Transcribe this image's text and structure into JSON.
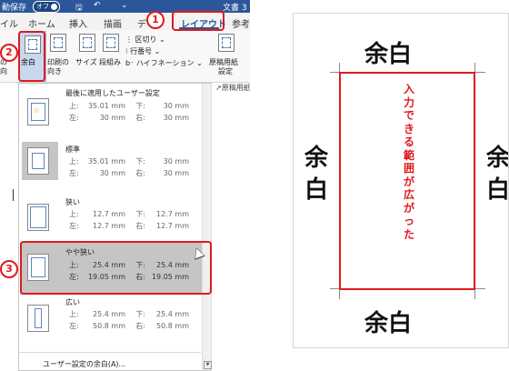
{
  "titlebar": {
    "autosave_left": "動保存",
    "autosave_state": "オフ",
    "doc_name": "文書 3 -"
  },
  "tabs": [
    "イル",
    "ホーム",
    "挿入",
    "描画",
    "デ",
    "レイアウト",
    "参考"
  ],
  "ribbon": {
    "margins_label": "余白",
    "orientation_label_1": "印刷の",
    "orientation_label_2": "向き",
    "size_label": "サイズ",
    "columns_label": "段組み",
    "breaks_label": "区切り",
    "line_numbers_label": "行番号",
    "hyphenation_label": "ハイフネーション",
    "manuscript_label_1": "原稿用紙",
    "manuscript_label_2": "設定",
    "left_cut_1": "の",
    "left_cut_2": "向",
    "side_group": "原稿用紙"
  },
  "margins_menu": {
    "options": [
      {
        "name": "最後に適用したユーザー設定",
        "top_label": "上:",
        "top": "35.01 mm",
        "bottom_label": "下:",
        "bottom": "30 mm",
        "left_label": "左:",
        "left": "30 mm",
        "right_label": "右:",
        "right": "30 mm"
      },
      {
        "name": "標準",
        "top_label": "上:",
        "top": "35.01 mm",
        "bottom_label": "下:",
        "bottom": "30 mm",
        "left_label": "左:",
        "left": "30 mm",
        "right_label": "右:",
        "right": "30 mm"
      },
      {
        "name": "狭い",
        "top_label": "上:",
        "top": "12.7 mm",
        "bottom_label": "下:",
        "bottom": "12.7 mm",
        "left_label": "左:",
        "left": "12.7 mm",
        "right_label": "右:",
        "right": "12.7 mm"
      },
      {
        "name": "やや狭い",
        "top_label": "上:",
        "top": "25.4 mm",
        "bottom_label": "下:",
        "bottom": "25.4 mm",
        "left_label": "左:",
        "left": "19.05 mm",
        "right_label": "右:",
        "right": "19.05 mm"
      },
      {
        "name": "広い",
        "top_label": "上:",
        "top": "25.4 mm",
        "bottom_label": "下:",
        "bottom": "25.4 mm",
        "left_label": "左:",
        "left": "50.8 mm",
        "right_label": "右:",
        "right": "50.8 mm"
      }
    ],
    "custom_link": "ユーザー設定の余白(A)..."
  },
  "badges": {
    "one": "1",
    "two": "2",
    "three": "3"
  },
  "diagram": {
    "top_margin": "余白",
    "bottom_margin": "余白",
    "left_margin": "余白",
    "right_margin": "余白",
    "text_area": "入力できる範囲が広がった"
  },
  "colors": {
    "accent": "#2b579a",
    "annotation": "#e1191e",
    "selected_row": "#c5c5c5"
  }
}
